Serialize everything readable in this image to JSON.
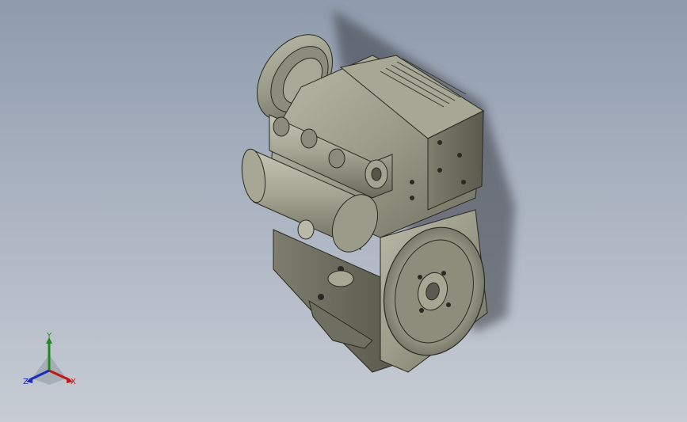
{
  "viewport": {
    "background_top": "#8f9bac",
    "background_bottom": "#c7ccd4",
    "model_color": "#9a9b88"
  },
  "triad": {
    "x_label": "X",
    "y_label": "Y",
    "z_label": "Z",
    "x_color": "#c01818",
    "y_color": "#1d8a1d",
    "z_color": "#1a2cc0"
  }
}
